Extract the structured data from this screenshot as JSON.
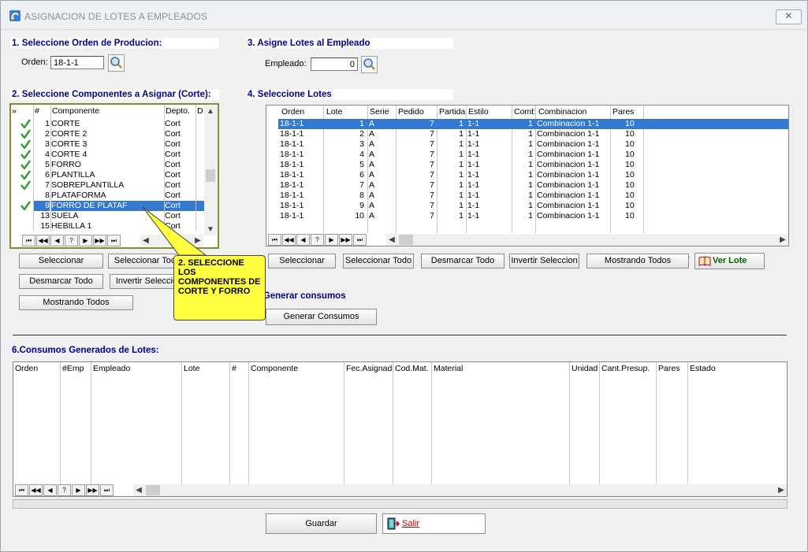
{
  "window": {
    "title": "ASIGNACION DE LOTES A EMPLEADOS",
    "close_glyph": "✕"
  },
  "section1": {
    "title": "1. Seleccione Orden de Producion:",
    "orden_label": "Orden:",
    "orden_value": "18-1-1"
  },
  "section2": {
    "title": "2. Seleccione Componentes a Asignar (Corte):",
    "headers": {
      "indicator": "»",
      "num": "#",
      "componente": "Componente",
      "depto": "Depto.",
      "d": "D"
    },
    "rows": [
      {
        "checked": true,
        "num": "1",
        "componente": "CORTE",
        "depto": "Cort"
      },
      {
        "checked": true,
        "num": "2",
        "componente": "CORTE 2",
        "depto": "Cort"
      },
      {
        "checked": true,
        "num": "3",
        "componente": "CORTE 3",
        "depto": "Cort"
      },
      {
        "checked": true,
        "num": "4",
        "componente": "CORTE 4",
        "depto": "Cort"
      },
      {
        "checked": true,
        "num": "5",
        "componente": "FORRO",
        "depto": "Cort"
      },
      {
        "checked": true,
        "num": "6",
        "componente": "PLANTILLA",
        "depto": "Cort"
      },
      {
        "checked": true,
        "num": "7",
        "componente": "SOBREPLANTILLA",
        "depto": "Cort"
      },
      {
        "checked": false,
        "num": "8",
        "componente": "PLATAFORMA",
        "depto": "Cort"
      },
      {
        "checked": true,
        "num": "9",
        "componente": "FORRO DE PLATAF",
        "depto": "Cort",
        "selected": true
      },
      {
        "checked": false,
        "num": "13",
        "componente": "SUELA",
        "depto": "Cort"
      },
      {
        "checked": false,
        "num": "15",
        "componente": "HEBILLA 1",
        "depto": "Cort"
      }
    ],
    "buttons": {
      "seleccionar": "Seleccionar",
      "seleccionar_todo": "Seleccionar Todo",
      "desmarcar_todo": "Desmarcar Todo",
      "invertir": "Invertir Seleccion",
      "mostrando": "Mostrando Todos"
    }
  },
  "section3": {
    "title": "3. Asigne Lotes al Empleado",
    "empleado_label": "Empleado:",
    "empleado_value": "0"
  },
  "section4": {
    "title": "4. Seleccione Lotes",
    "headers": {
      "orden": "Orden",
      "lote": "Lote",
      "serie": "Serie",
      "pedido": "Pedido",
      "partida": "Partida",
      "estilo": "Estilo",
      "comb": "Comb",
      "combinacion": "Combinacion",
      "pares": "Pares"
    },
    "rows": [
      {
        "orden": "18-1-1",
        "lote": "1",
        "serie": "A",
        "pedido": "7",
        "partida": "1",
        "estilo": "1-1",
        "comb": "1",
        "combinacion": "Combinacion 1-1",
        "pares": "10",
        "selected": true
      },
      {
        "orden": "18-1-1",
        "lote": "2",
        "serie": "A",
        "pedido": "7",
        "partida": "1",
        "estilo": "1-1",
        "comb": "1",
        "combinacion": "Combinacion 1-1",
        "pares": "10"
      },
      {
        "orden": "18-1-1",
        "lote": "3",
        "serie": "A",
        "pedido": "7",
        "partida": "1",
        "estilo": "1-1",
        "comb": "1",
        "combinacion": "Combinacion 1-1",
        "pares": "10"
      },
      {
        "orden": "18-1-1",
        "lote": "4",
        "serie": "A",
        "pedido": "7",
        "partida": "1",
        "estilo": "1-1",
        "comb": "1",
        "combinacion": "Combinacion 1-1",
        "pares": "10"
      },
      {
        "orden": "18-1-1",
        "lote": "5",
        "serie": "A",
        "pedido": "7",
        "partida": "1",
        "estilo": "1-1",
        "comb": "1",
        "combinacion": "Combinacion 1-1",
        "pares": "10"
      },
      {
        "orden": "18-1-1",
        "lote": "6",
        "serie": "A",
        "pedido": "7",
        "partida": "1",
        "estilo": "1-1",
        "comb": "1",
        "combinacion": "Combinacion 1-1",
        "pares": "10"
      },
      {
        "orden": "18-1-1",
        "lote": "7",
        "serie": "A",
        "pedido": "7",
        "partida": "1",
        "estilo": "1-1",
        "comb": "1",
        "combinacion": "Combinacion 1-1",
        "pares": "10"
      },
      {
        "orden": "18-1-1",
        "lote": "8",
        "serie": "A",
        "pedido": "7",
        "partida": "1",
        "estilo": "1-1",
        "comb": "1",
        "combinacion": "Combinacion 1-1",
        "pares": "10"
      },
      {
        "orden": "18-1-1",
        "lote": "9",
        "serie": "A",
        "pedido": "7",
        "partida": "1",
        "estilo": "1-1",
        "comb": "1",
        "combinacion": "Combinacion 1-1",
        "pares": "10"
      },
      {
        "orden": "18-1-1",
        "lote": "10",
        "serie": "A",
        "pedido": "7",
        "partida": "1",
        "estilo": "1-1",
        "comb": "1",
        "combinacion": "Combinacion 1-1",
        "pares": "10"
      }
    ],
    "buttons": {
      "seleccionar": "Seleccionar",
      "seleccionar_todo": "Seleccionar Todo",
      "desmarcar_todo": "Desmarcar Todo",
      "invertir": "Invertir Seleccion",
      "mostrando": "Mostrando Todos",
      "ver_lote": "Ver Lote"
    }
  },
  "section5": {
    "title": "5. Generar consumos",
    "generar_button": "Generar Consumos"
  },
  "section6": {
    "title": "6.Consumos Generados de Lotes:",
    "headers": {
      "orden": "Orden",
      "emp": "#Emp",
      "empleado": "Empleado",
      "lote": "Lote",
      "num": "#",
      "componente": "Componente",
      "fec": "Fec.Asignado",
      "codmat": "Cod.Mat.",
      "material": "Material",
      "unidad": "Unidad",
      "cant": "Cant.Presup.",
      "pares": "Pares",
      "estado": "Estado"
    }
  },
  "tooltip": {
    "text": "2. SELECCIONE LOS COMPONENTES DE CORTE Y FORRO"
  },
  "footer": {
    "guardar": "Guardar",
    "salir": "Salir"
  },
  "nav": {
    "first": "⏮",
    "prev_page": "◀◀",
    "prev": "◀",
    "help": "?",
    "next": "▶",
    "next_page": "▶▶",
    "last": "⏭"
  },
  "colors": {
    "section_title": "#00008b",
    "selection": "#3478d0",
    "tooltip_bg": "#ffff40",
    "check": "#2e9e2e"
  }
}
